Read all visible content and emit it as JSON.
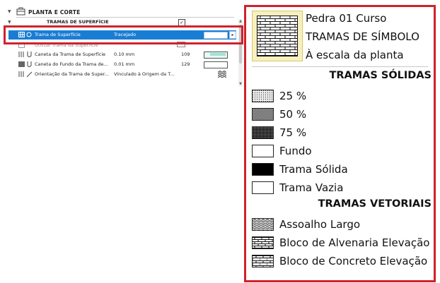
{
  "left_panel": {
    "section_title": "PLANTA E CORTE",
    "subsection_title": "TRAMAS DE SUPERFÍCIE",
    "subsection_check": "✓",
    "rows": [
      {
        "name": "Trama de Superfície",
        "value": "Tracejado",
        "number": "",
        "arrow": "▸"
      },
      {
        "name": "Utilizar Trama da Superfície",
        "value": "",
        "number": ""
      },
      {
        "name": "Caneta da Trama de Superfície",
        "value": "0.10 mm",
        "number": "109"
      },
      {
        "name": "Caneta do Fundo da Trama de...",
        "value": "0.01 mm",
        "number": "129"
      },
      {
        "name": "Orientação da Trama de Super...",
        "value": "Vinculado à Origem da T...",
        "number": ""
      }
    ],
    "scroll_up": "▲",
    "scroll_down": "▼"
  },
  "dropdown": {
    "selected": {
      "line1": "Pedra 01 Curso",
      "line2": "TRAMAS DE SÍMBOLO",
      "line3": "À escala da planta"
    },
    "solid_header": "TRAMAS SÓLIDAS",
    "solid_items": [
      {
        "label": "25 %",
        "fill": "pct25"
      },
      {
        "label": "50 %",
        "fill": "pct50"
      },
      {
        "label": "75 %",
        "fill": "pct75"
      },
      {
        "label": "Fundo",
        "fill": "empty"
      },
      {
        "label": "Trama Sólida",
        "fill": "solid"
      },
      {
        "label": "Trama Vazia",
        "fill": "empty"
      }
    ],
    "vector_header": "TRAMAS VETORIAIS",
    "vector_items": [
      {
        "label": "Assoalho Largo",
        "fill": "floor"
      },
      {
        "label": "Bloco de Alvenaria Elevação",
        "fill": "brick"
      },
      {
        "label": "Bloco de Concreto Elevação",
        "fill": "block"
      }
    ]
  },
  "colors": {
    "highlight": "#d0222b",
    "selection": "#1a7dd4",
    "selected_swatch_bg": "#f7efc0"
  }
}
